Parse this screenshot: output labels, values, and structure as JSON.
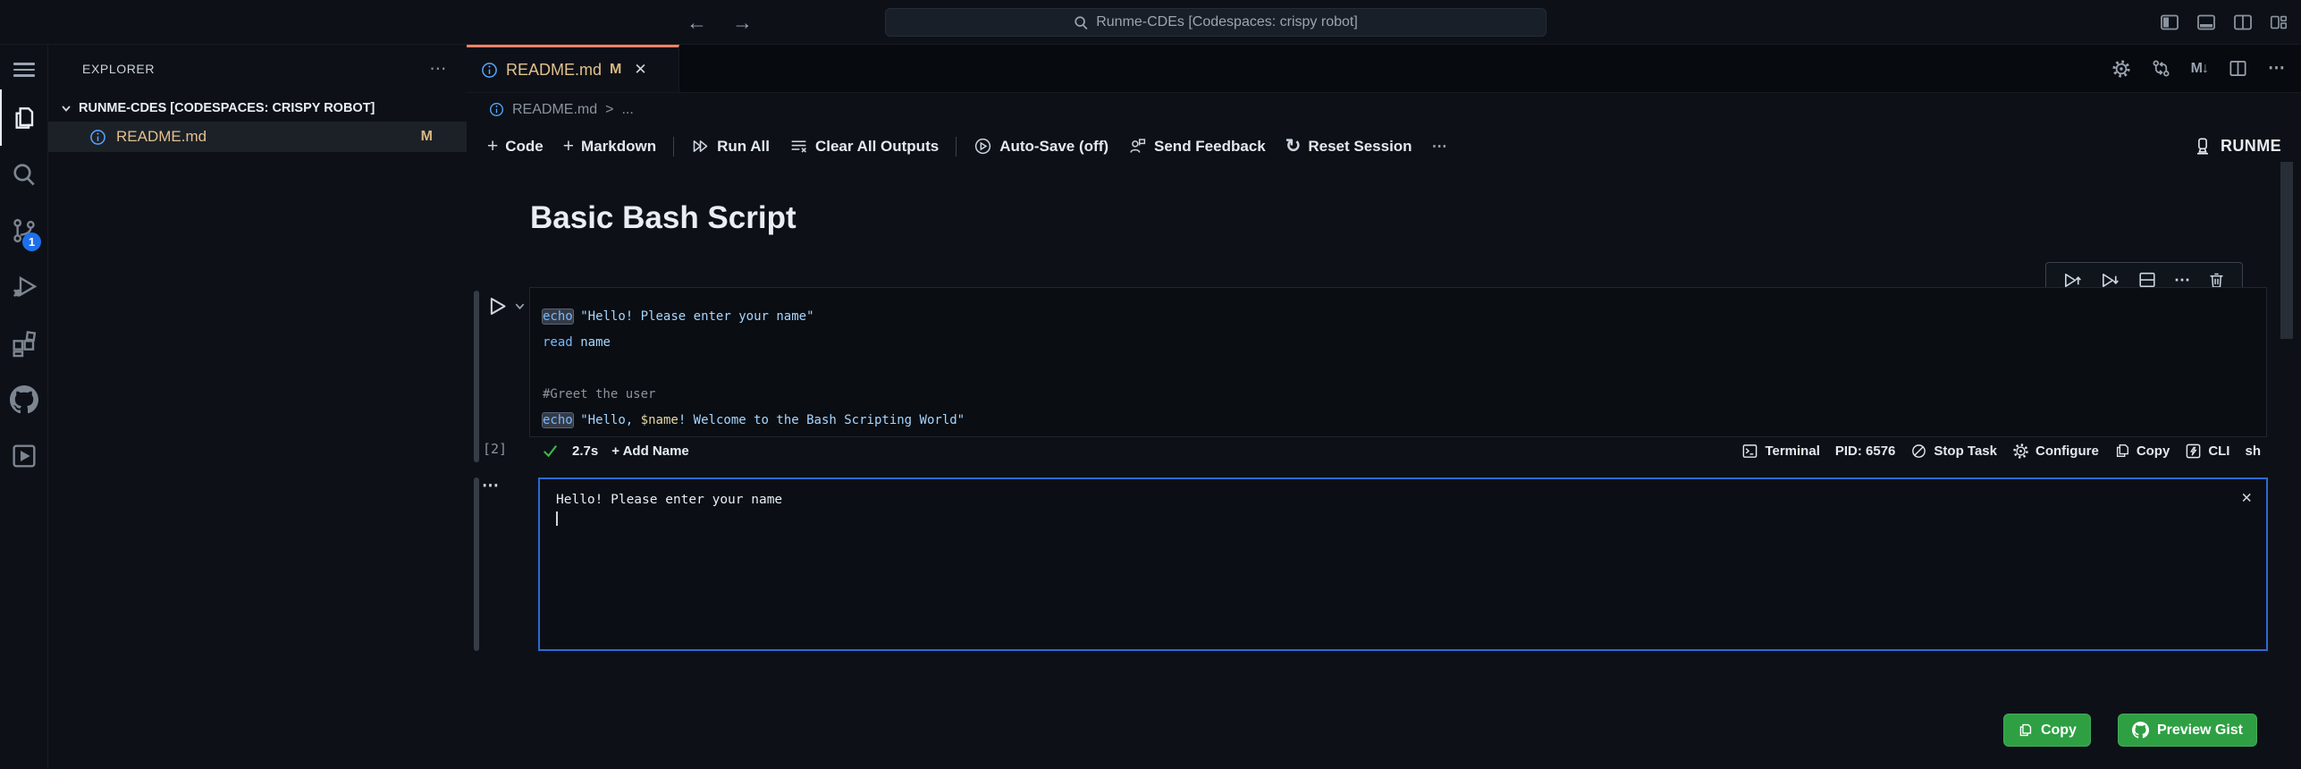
{
  "titlebar": {
    "search": "Runme-CDEs [Codespaces: crispy robot]"
  },
  "activity": {
    "scm_badge": "1"
  },
  "sidebar": {
    "title": "EXPLORER",
    "section": "RUNME-CDES [CODESPACES: CRISPY ROBOT]",
    "file_name": "README.md",
    "file_badge": "M"
  },
  "tabbar": {
    "tab_name": "README.md",
    "tab_badge": "M"
  },
  "breadcrumb": {
    "file": "README.md",
    "sep": ">",
    "more": "..."
  },
  "toolbar": {
    "code": "Code",
    "markdown": "Markdown",
    "run_all": "Run All",
    "clear": "Clear All Outputs",
    "autosave": "Auto-Save (off)",
    "feedback": "Send Feedback",
    "reset": "Reset Session",
    "brand": "RUNME"
  },
  "doc": {
    "title": "Basic Bash Script"
  },
  "cell": {
    "exec_order": "[2]",
    "code": {
      "l1_cmd": "echo",
      "l1_str": "\"Hello! Please enter your name\"",
      "l2_cmd": "read",
      "l2_arg": "name",
      "l4_comment": "#Greet the user",
      "l5_cmd": "echo",
      "l5_str_a": "\"Hello, ",
      "l5_var": "$name",
      "l5_str_b": "! Welcome to the Bash Scripting World\""
    },
    "status": {
      "duration": "2.7s",
      "add_name": "+ Add Name",
      "terminal": "Terminal",
      "pid": "PID: 6576",
      "stop": "Stop Task",
      "configure": "Configure",
      "copy": "Copy",
      "cli": "CLI",
      "lang": "sh"
    }
  },
  "output": {
    "line1": "Hello! Please enter your name"
  },
  "gist": {
    "copy": "Copy",
    "preview": "Preview Gist"
  },
  "icons": {
    "arrow_left": "←",
    "arrow_right": "→",
    "kebab": "⋯",
    "close": "✕",
    "markdown_preview": "M↓",
    "reset": "↻",
    "plus": "+"
  },
  "colors": {
    "background": "#0d1117",
    "tab_accent_orange": "#f78166",
    "modified_gold": "#e2c08d",
    "info_blue": "#58a6ff",
    "badge_blue": "#1f6feb",
    "success_green": "#3fb950",
    "button_green": "#2ea043",
    "output_border_blue": "#2e6ad4",
    "code_command_blue": "#79b8ff",
    "code_string_blue": "#a5d6ff",
    "code_variable": "#e3d7a3",
    "comment_gray": "#8b949e"
  }
}
